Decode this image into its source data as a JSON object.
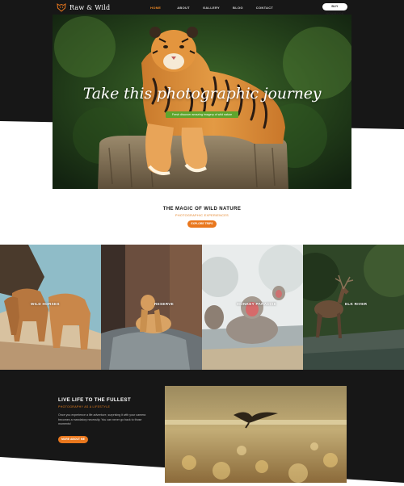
{
  "brand": {
    "name": "Raw & Wild",
    "logo_icon": "tiger-head-icon"
  },
  "nav": {
    "items": [
      {
        "label": "HOME",
        "active": true
      },
      {
        "label": "ABOUT",
        "active": false
      },
      {
        "label": "GALLERY",
        "active": false
      },
      {
        "label": "BLOG",
        "active": false
      },
      {
        "label": "CONTACT",
        "active": false
      }
    ],
    "book_button": "BUY NOW/BOOK"
  },
  "hero": {
    "title": "Take this photographic journey",
    "subtitle": "Fresh discover amazing imagery of wild nature"
  },
  "intro": {
    "title": "THE MAGIC OF WILD NATURE",
    "subtitle": "PHOTOGRAPHIC EXPERIENCES",
    "button": "EXPLORE TRIPS"
  },
  "gallery": [
    {
      "label": "WILD HORSES"
    },
    {
      "label": "RESERVE"
    },
    {
      "label": "MONKEY PARADISE"
    },
    {
      "label": "ELK RIVER"
    }
  ],
  "lifestyle": {
    "title": "LIVE LIFE TO THE FULLEST",
    "subtitle": "PHOTOGRAPHY AS A LIFESTYLE",
    "body": "Once you experience a life adventure, surprising it with your camera becomes a mandatory necessity. You can never go back to those moments!",
    "button": "MORE ABOUT ME"
  },
  "colors": {
    "dark_band": "#171717",
    "accent_orange": "#e9771d",
    "accent_green": "#5ea52d"
  }
}
